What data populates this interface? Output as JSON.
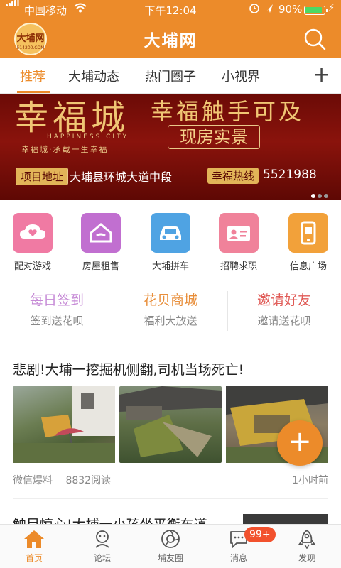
{
  "status_bar": {
    "carrier": "中国移动",
    "time": "下午12:04",
    "battery_percent": "90%",
    "battery_level": 0.9
  },
  "header": {
    "logo_text": "大埔网",
    "logo_url_text": "514200.COM",
    "title": "大埔网",
    "search_icon": "search-icon"
  },
  "tabs": [
    {
      "label": "推荐",
      "active": true
    },
    {
      "label": "大埔动态"
    },
    {
      "label": "热门圈子"
    },
    {
      "label": "小视界"
    }
  ],
  "banner": {
    "title": "幸福城",
    "subtitle_en": "HAPPINESS CITY",
    "slogan": "幸福城·承载一生幸福",
    "headline": "幸福触手可及",
    "tagline": "现房实景",
    "address_label": "项目地址",
    "address": "大埔县环城大道中段",
    "hotline_label": "幸福热线",
    "hotline": "5521988",
    "slides": 3,
    "active_slide": 1
  },
  "shortcuts": [
    {
      "label": "配对游戏",
      "icon": "cloud-heart-icon",
      "color": "#f07aa3"
    },
    {
      "label": "房屋租售",
      "icon": "house-icon",
      "color": "#c16fd0"
    },
    {
      "label": "大埔拼车",
      "icon": "car-icon",
      "color": "#4fa3e3"
    },
    {
      "label": "招聘求职",
      "icon": "id-card-icon",
      "color": "#f0829a"
    },
    {
      "label": "信息广场",
      "icon": "phone-icon",
      "color": "#f2a13a"
    }
  ],
  "promos": [
    {
      "title": "每日签到",
      "subtitle": "签到送花呗",
      "color": "#c68ad6"
    },
    {
      "title": "花贝商城",
      "subtitle": "福利大放送",
      "color": "#e88e3a"
    },
    {
      "title": "邀请好友",
      "subtitle": "邀请送花呗",
      "color": "#e05a56"
    }
  ],
  "post": {
    "title": "悲剧!大埔一挖掘机侧翻,司机当场死亡!",
    "source": "微信爆料",
    "reads": "8832阅读",
    "time": "1小时前"
  },
  "next_post": {
    "title": "触目惊心!大埔一小孩坐平衡车道"
  },
  "bottom_nav": [
    {
      "label": "首页",
      "icon": "home-icon",
      "active": true
    },
    {
      "label": "论坛",
      "icon": "forum-icon"
    },
    {
      "label": "埔友圈",
      "icon": "camera-circle-icon"
    },
    {
      "label": "消息",
      "icon": "message-icon"
    },
    {
      "label": "发现",
      "icon": "rocket-icon"
    }
  ],
  "messages_badge": "99+",
  "colors": {
    "brand": "#ec8b2a"
  }
}
